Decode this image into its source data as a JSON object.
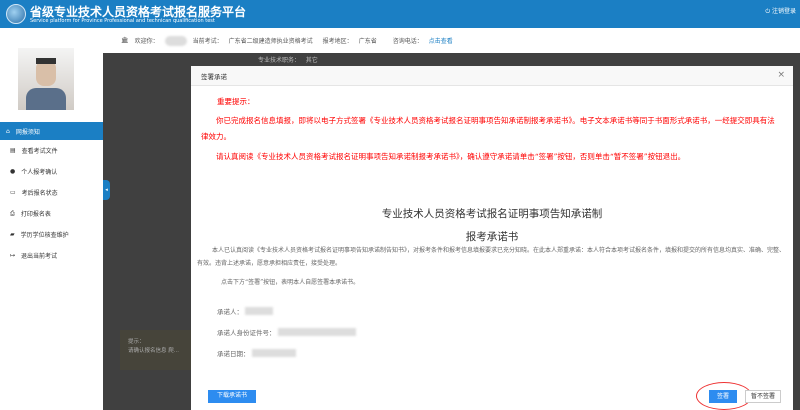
{
  "header": {
    "title": "省级专业技术人员资格考试报名服务平台",
    "subtitle": "Service platform for Province Professional and technican qualification test",
    "logout": "注销登录",
    "colors": {
      "brand": "#1b7fc4"
    }
  },
  "infobar": {
    "welcome": "欢迎你：",
    "exam_label": "当前考试：",
    "exam": "广东省二级建造师执业资格考试",
    "region_label": "报考地区：",
    "region": "广东省",
    "phone_label": "咨询电话：",
    "phone_link": "点击查看"
  },
  "sidebar": {
    "items": [
      {
        "label": "网报须知",
        "icon": "home-icon"
      },
      {
        "label": "查看考试文件",
        "icon": "file-icon"
      },
      {
        "label": "个人报考确认",
        "icon": "info-icon"
      },
      {
        "label": "考后报名状态",
        "icon": "monitor-icon"
      },
      {
        "label": "打印报名表",
        "icon": "print-icon"
      },
      {
        "label": "学历学位核查维护",
        "icon": "graduation-icon"
      },
      {
        "label": "退出当前考试",
        "icon": "exit-icon"
      }
    ]
  },
  "background": {
    "field_label": "专业技术职务：",
    "field_value": "其它",
    "tip_title": "提示：",
    "tip_text": "请确认报名信息 爬..."
  },
  "dialog": {
    "title": "签署承诺",
    "close": "×",
    "warning_heading": "重要提示：",
    "warning_p1": "你已完成报名信息填报，即将以电子方式签署《专业技术人员资格考试报名证明事项告知承诺制报考承诺书》。电子文本承诺书等同于书面形式承诺书，一经提交即具有法律效力。",
    "warning_p2": "请认真阅读《专业技术人员资格考试报名证明事项告知承诺制报考承诺书》，确认遵守承诺请单击“签署”按钮，否则单击“暂不签署”按钮退出。",
    "doc_title": "专业技术人员资格考试报名证明事项告知承诺制",
    "doc_subtitle": "报考承诺书",
    "doc_p1": "本人已认真阅读《专业技术人员资格考试报名证明事项告知承诺制告知书》，对报考条件和报考信息填报要求已充分知晓。在此本人郑重承诺：本人符合本项考试报名条件，填报和提交的所有信息均真实、准确、完整、有效。违背上述承诺，愿意承担相应责任，接受处理。",
    "doc_p2": "点击下方“签署”按钮，表明本人自愿签署本承诺书。",
    "promiser_label": "承诺人：",
    "id_label": "承诺人身份证件号：",
    "date_label": "承诺日期：",
    "download_button": "下载承诺书",
    "sign_button": "签署",
    "later_button": "暂不签署",
    "colors": {
      "warning": "#ff0000",
      "primary": "#2d8cf0",
      "highlight_ring": "#e33333"
    }
  }
}
